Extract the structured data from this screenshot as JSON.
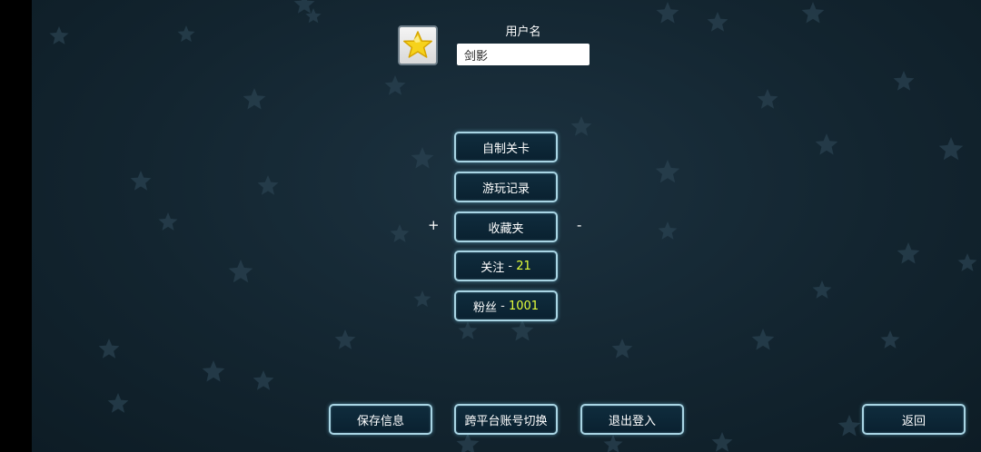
{
  "profile": {
    "username_label": "用户名",
    "username_value": "剑影",
    "avatar_icon": "star-icon"
  },
  "menu": {
    "custom_levels": "自制关卡",
    "play_history": "游玩记录",
    "favorites": "收藏夹",
    "favorites_add": "+",
    "favorites_remove": "-",
    "following": {
      "label": "关注",
      "separator": " - ",
      "count": "21"
    },
    "fans": {
      "label": "粉丝",
      "separator": " - ",
      "count": "1001"
    }
  },
  "footer": {
    "save_info": "保存信息",
    "cross_platform_switch": "跨平台账号切换",
    "logout": "退出登入",
    "back": "返回"
  },
  "colors": {
    "background": "#132530",
    "button_border": "#a9d5e4",
    "count_highlight": "#e6ff3a",
    "avatar_star": "#f6d21c"
  }
}
